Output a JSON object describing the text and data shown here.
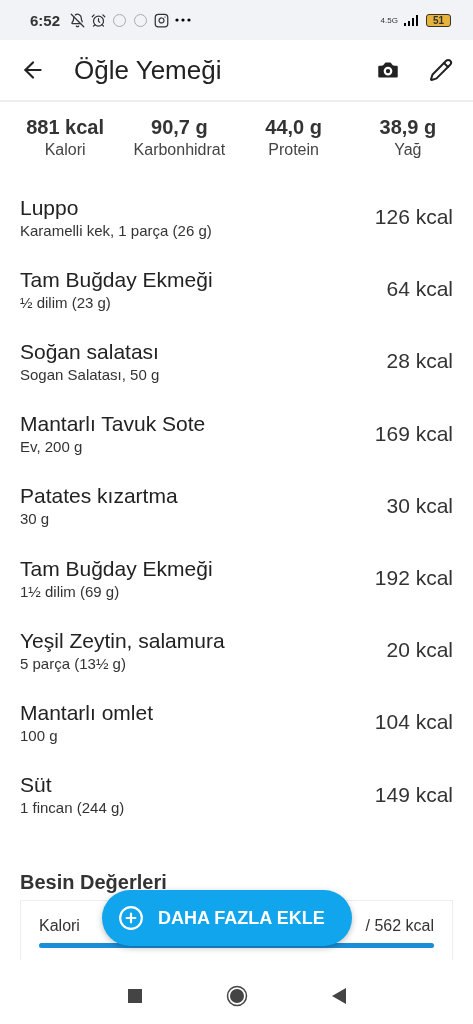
{
  "status_bar": {
    "time": "6:52",
    "network": "4.5G",
    "battery": "51"
  },
  "header": {
    "title": "Öğle Yemeği"
  },
  "summary": [
    {
      "value": "881 kcal",
      "label": "Kalori"
    },
    {
      "value": "90,7 g",
      "label": "Karbonhidrat"
    },
    {
      "value": "44,0 g",
      "label": "Protein"
    },
    {
      "value": "38,9 g",
      "label": "Yağ"
    }
  ],
  "foods": [
    {
      "name": "Luppo",
      "detail": "Karamelli kek, 1 parça (26 g)",
      "calories": "126 kcal"
    },
    {
      "name": "Tam Buğday Ekmeği",
      "detail": "½ dilim (23 g)",
      "calories": "64 kcal"
    },
    {
      "name": "Soğan salatası",
      "detail": "Sogan Salatası, 50 g",
      "calories": "28 kcal"
    },
    {
      "name": "Mantarlı Tavuk Sote",
      "detail": "Ev, 200 g",
      "calories": "169 kcal"
    },
    {
      "name": "Patates kızartma",
      "detail": "30 g",
      "calories": "30 kcal"
    },
    {
      "name": "Tam Buğday Ekmeği",
      "detail": "1½ dilim (69 g)",
      "calories": "192 kcal"
    },
    {
      "name": "Yeşil Zeytin, salamura",
      "detail": "5 parça (13½ g)",
      "calories": "20 kcal"
    },
    {
      "name": "Mantarlı omlet",
      "detail": "100 g",
      "calories": "104 kcal"
    },
    {
      "name": "Süt",
      "detail": "1 fincan (244 g)",
      "calories": "149 kcal"
    }
  ],
  "nutrition": {
    "title": "Besin Değerleri",
    "rows": [
      {
        "label": "Kalori",
        "value": "/ 562 kcal",
        "level": 1
      }
    ]
  },
  "fab": {
    "label": "DAHA FAZLA EKLE"
  }
}
